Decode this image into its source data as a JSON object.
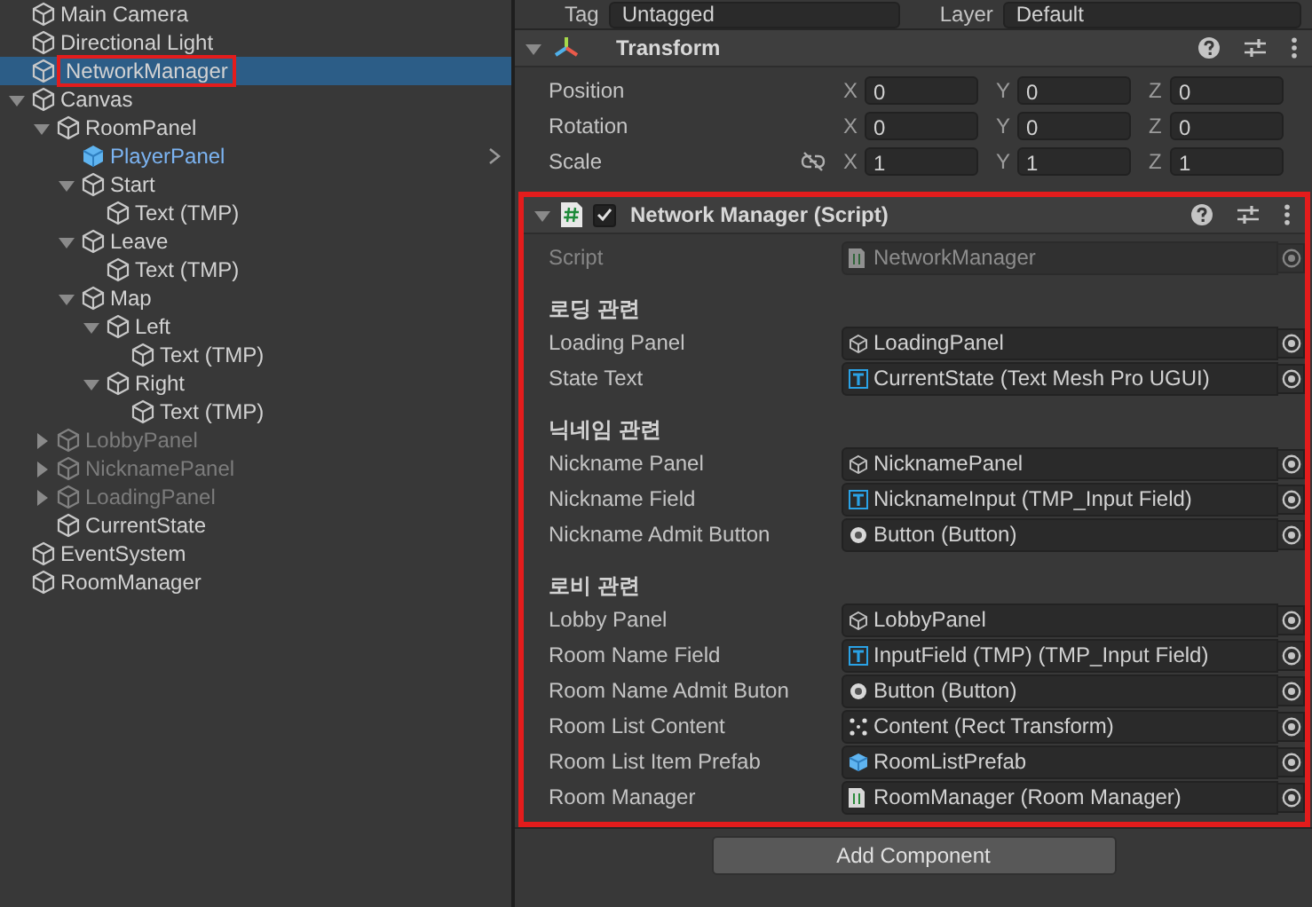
{
  "hierarchy": {
    "items": [
      {
        "name": "Main Camera",
        "selected": false
      },
      {
        "name": "Directional Light",
        "selected": false
      },
      {
        "name": "NetworkManager",
        "selected": true,
        "highlighted": true
      },
      {
        "name": "Canvas",
        "selected": false,
        "expanded": true,
        "children": [
          {
            "name": "RoomPanel",
            "selected": false,
            "expanded": true,
            "children": [
              {
                "name": "PlayerPanel",
                "selected": false,
                "kind": "prefab",
                "has_submenu": true
              },
              {
                "name": "Start",
                "selected": false,
                "expanded": true,
                "children": [
                  {
                    "name": "Text (TMP)",
                    "selected": false
                  }
                ]
              },
              {
                "name": "Leave",
                "selected": false,
                "expanded": true,
                "children": [
                  {
                    "name": "Text (TMP)",
                    "selected": false
                  }
                ]
              },
              {
                "name": "Map",
                "selected": false,
                "expanded": true,
                "children": [
                  {
                    "name": "Left",
                    "selected": false,
                    "expanded": true,
                    "children": [
                      {
                        "name": "Text (TMP)",
                        "selected": false
                      }
                    ]
                  },
                  {
                    "name": "Right",
                    "selected": false,
                    "expanded": true,
                    "children": [
                      {
                        "name": "Text (TMP)",
                        "selected": false
                      }
                    ]
                  }
                ]
              }
            ]
          },
          {
            "name": "LobbyPanel",
            "selected": false,
            "expanded": false,
            "inactive": true
          },
          {
            "name": "NicknamePanel",
            "selected": false,
            "expanded": false,
            "inactive": true
          },
          {
            "name": "LoadingPanel",
            "selected": false,
            "expanded": false,
            "inactive": true
          },
          {
            "name": "CurrentState",
            "selected": false
          }
        ]
      },
      {
        "name": "EventSystem",
        "selected": false
      },
      {
        "name": "RoomManager",
        "selected": false
      }
    ]
  },
  "inspector": {
    "tag_row": {
      "tag_label": "Tag",
      "tag_value": "Untagged",
      "layer_label": "Layer",
      "layer_value": "Default"
    },
    "transform": {
      "title": "Transform",
      "expanded": true,
      "rows": [
        {
          "label": "Position",
          "fields": [
            {
              "axis": "X",
              "value": "0"
            },
            {
              "axis": "Y",
              "value": "0"
            },
            {
              "axis": "Z",
              "value": "0"
            }
          ]
        },
        {
          "label": "Rotation",
          "fields": [
            {
              "axis": "X",
              "value": "0"
            },
            {
              "axis": "Y",
              "value": "0"
            },
            {
              "axis": "Z",
              "value": "0"
            }
          ]
        },
        {
          "label": "Scale",
          "proportional_lock": false,
          "fields": [
            {
              "axis": "X",
              "value": "1"
            },
            {
              "axis": "Y",
              "value": "1"
            },
            {
              "axis": "Z",
              "value": "1"
            }
          ]
        }
      ]
    },
    "component": {
      "title": "Network Manager (Script)",
      "expanded": true,
      "enabled": true,
      "highlighted": true,
      "fields": [
        {
          "kind": "script",
          "label": "Script",
          "value": "NetworkManager",
          "disabled": true
        },
        {
          "kind": "header",
          "text": "로딩 관련"
        },
        {
          "kind": "object",
          "label": "Loading Panel",
          "value": "LoadingPanel",
          "disabled": false
        },
        {
          "kind": "text",
          "label": "State Text",
          "value": "CurrentState (Text Mesh Pro UGUI)",
          "disabled": false
        },
        {
          "kind": "header",
          "text": "닉네임 관련"
        },
        {
          "kind": "object",
          "label": "Nickname Panel",
          "value": "NicknamePanel",
          "disabled": false
        },
        {
          "kind": "text",
          "label": "Nickname Field",
          "value": "NicknameInput (TMP_Input Field)",
          "disabled": false
        },
        {
          "kind": "button",
          "label": "Nickname Admit Button",
          "value": "Button (Button)",
          "disabled": false
        },
        {
          "kind": "header",
          "text": "로비 관련"
        },
        {
          "kind": "object",
          "label": "Lobby Panel",
          "value": "LobbyPanel",
          "disabled": false
        },
        {
          "kind": "text",
          "label": "Room Name Field",
          "value": "InputField (TMP) (TMP_Input Field)",
          "disabled": false
        },
        {
          "kind": "button",
          "label": "Room Name Admit Buton",
          "value": "Button (Button)",
          "disabled": false
        },
        {
          "kind": "rect",
          "label": "Room List Content",
          "value": "Content (Rect Transform)",
          "disabled": false
        },
        {
          "kind": "prefab",
          "label": "Room List Item Prefab",
          "value": "RoomListPrefab",
          "disabled": false
        },
        {
          "kind": "script",
          "label": "Room Manager",
          "value": "RoomManager (Room Manager)",
          "disabled": false
        }
      ]
    },
    "add_component": "Add Component"
  }
}
